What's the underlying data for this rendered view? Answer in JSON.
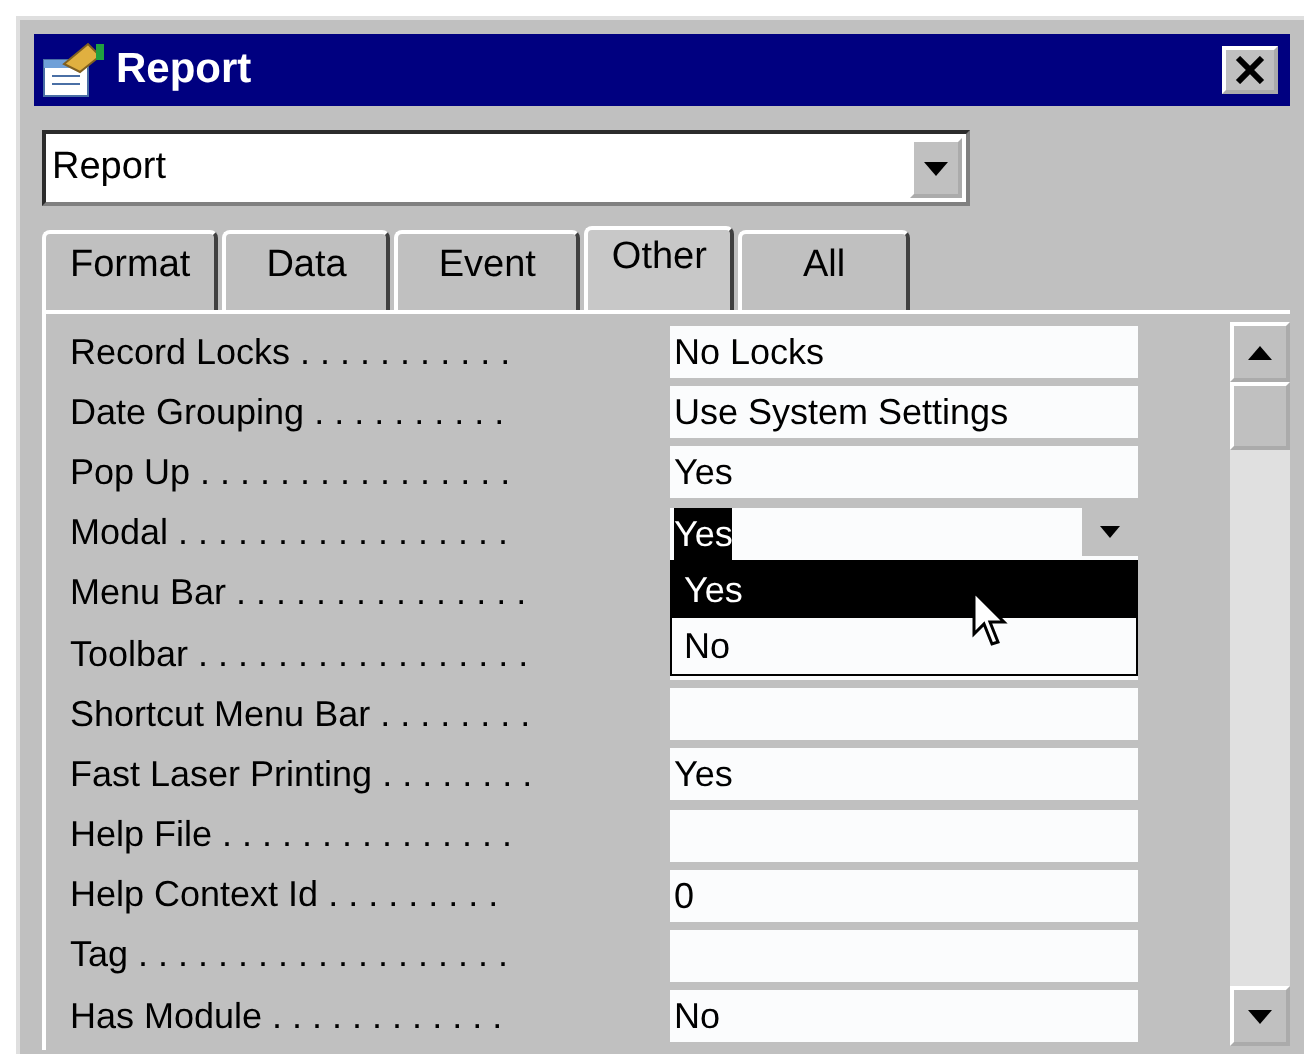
{
  "window": {
    "title": "Report"
  },
  "object_selector": {
    "value": "Report"
  },
  "tabs": [
    {
      "label": "Format",
      "selected": false
    },
    {
      "label": "Data",
      "selected": false
    },
    {
      "label": "Event",
      "selected": false
    },
    {
      "label": "Other",
      "selected": true
    },
    {
      "label": "All",
      "selected": false
    }
  ],
  "properties": [
    {
      "kind": "text",
      "label": "Record Locks . . . . . . . . . . .",
      "value": "No Locks"
    },
    {
      "kind": "text",
      "label": "Date Grouping . . . . . . . . . .",
      "value": "Use System Settings"
    },
    {
      "kind": "text",
      "label": "Pop Up . . . . . . . . . . . . . . . .",
      "value": "Yes"
    },
    {
      "kind": "dropdown",
      "label": "Modal . . . . . . . . . . . . . . . . .",
      "value": "Yes",
      "expanded": true,
      "options": [
        {
          "label": "Yes",
          "selected": true
        },
        {
          "label": "No",
          "selected": false
        }
      ]
    },
    {
      "kind": "text",
      "label": "Menu Bar . . . . . . . . . . . . . . ."
    },
    {
      "kind": "text",
      "label": "Toolbar . . . . . . . . . . . . . . . . ."
    },
    {
      "kind": "text",
      "label": "Shortcut Menu Bar . . . . . . . ."
    },
    {
      "kind": "text",
      "label": "Fast Laser Printing . . . . . . . .",
      "value": "Yes"
    },
    {
      "kind": "text",
      "label": "Help File . . . . . . . . . . . . . . ."
    },
    {
      "kind": "text",
      "label": "Help Context Id . . . . . . . . .",
      "value": "0"
    },
    {
      "kind": "text",
      "label": "Tag . . . . . . . . . . . . . . . . . . ."
    },
    {
      "kind": "text",
      "label": "Has Module . . . . . . . . . . . .",
      "value": "No"
    }
  ]
}
